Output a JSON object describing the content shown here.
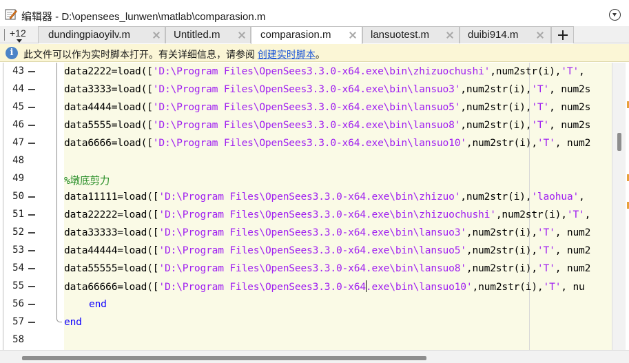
{
  "window": {
    "title": "编辑器 - D:\\opensees_lunwen\\matlab\\comparasion.m",
    "app_icon": "matlab-editor-icon",
    "menu_icon": "chevron-circle-down-icon"
  },
  "tabs": {
    "overflow_count": "+12",
    "items": [
      {
        "label": "dundingpiaoyilv.m",
        "active": false
      },
      {
        "label": "Untitled.m",
        "active": false
      },
      {
        "label": "comparasion.m",
        "active": true
      },
      {
        "label": "lansuotest.m",
        "active": false
      },
      {
        "label": "duibi914.m",
        "active": false
      }
    ],
    "new_tab_icon": "plus-icon"
  },
  "infobar": {
    "text": "此文件可以作为实时脚本打开。有关详细信息，请参阅 ",
    "link": "创建实时脚本",
    "suffix": "。"
  },
  "editor": {
    "lines": [
      {
        "num": "43",
        "dash": true,
        "segments": [
          {
            "t": "n",
            "s": "data2222=load(["
          },
          {
            "t": "s",
            "s": "'D:\\Program Files\\OpenSees3.3.0-x64.exe\\bin\\zhizuochushi'"
          },
          {
            "t": "n",
            "s": ",num2str(i),"
          },
          {
            "t": "s",
            "s": "'T'"
          },
          {
            "t": "n",
            "s": ","
          }
        ]
      },
      {
        "num": "44",
        "dash": true,
        "segments": [
          {
            "t": "n",
            "s": "data3333=load(["
          },
          {
            "t": "s",
            "s": "'D:\\Program Files\\OpenSees3.3.0-x64.exe\\bin\\lansuo3'"
          },
          {
            "t": "n",
            "s": ",num2str(i),"
          },
          {
            "t": "s",
            "s": "'T'"
          },
          {
            "t": "n",
            "s": ", num2s"
          }
        ]
      },
      {
        "num": "45",
        "dash": true,
        "segments": [
          {
            "t": "n",
            "s": "data4444=load(["
          },
          {
            "t": "s",
            "s": "'D:\\Program Files\\OpenSees3.3.0-x64.exe\\bin\\lansuo5'"
          },
          {
            "t": "n",
            "s": ",num2str(i),"
          },
          {
            "t": "s",
            "s": "'T'"
          },
          {
            "t": "n",
            "s": ", num2s"
          }
        ]
      },
      {
        "num": "46",
        "dash": true,
        "segments": [
          {
            "t": "n",
            "s": "data5555=load(["
          },
          {
            "t": "s",
            "s": "'D:\\Program Files\\OpenSees3.3.0-x64.exe\\bin\\lansuo8'"
          },
          {
            "t": "n",
            "s": ",num2str(i),"
          },
          {
            "t": "s",
            "s": "'T'"
          },
          {
            "t": "n",
            "s": ", num2s"
          }
        ]
      },
      {
        "num": "47",
        "dash": true,
        "segments": [
          {
            "t": "n",
            "s": "data6666=load(["
          },
          {
            "t": "s",
            "s": "'D:\\Program Files\\OpenSees3.3.0-x64.exe\\bin\\lansuo10'"
          },
          {
            "t": "n",
            "s": ",num2str(i),"
          },
          {
            "t": "s",
            "s": "'T'"
          },
          {
            "t": "n",
            "s": ", num2"
          }
        ]
      },
      {
        "num": "48",
        "dash": false,
        "segments": []
      },
      {
        "num": "49",
        "dash": false,
        "segments": [
          {
            "t": "c",
            "s": "%墩底剪力"
          }
        ]
      },
      {
        "num": "50",
        "dash": true,
        "segments": [
          {
            "t": "n",
            "s": "data11111=load(["
          },
          {
            "t": "s",
            "s": "'D:\\Program Files\\OpenSees3.3.0-x64.exe\\bin\\zhizuo'"
          },
          {
            "t": "n",
            "s": ",num2str(i),"
          },
          {
            "t": "s",
            "s": "'laohua'"
          },
          {
            "t": "n",
            "s": ","
          }
        ]
      },
      {
        "num": "51",
        "dash": true,
        "segments": [
          {
            "t": "n",
            "s": "data22222=load(["
          },
          {
            "t": "s",
            "s": "'D:\\Program Files\\OpenSees3.3.0-x64.exe\\bin\\zhizuochushi'"
          },
          {
            "t": "n",
            "s": ",num2str(i),"
          },
          {
            "t": "s",
            "s": "'T'"
          },
          {
            "t": "n",
            "s": ","
          }
        ]
      },
      {
        "num": "52",
        "dash": true,
        "segments": [
          {
            "t": "n",
            "s": "data33333=load(["
          },
          {
            "t": "s",
            "s": "'D:\\Program Files\\OpenSees3.3.0-x64.exe\\bin\\lansuo3'"
          },
          {
            "t": "n",
            "s": ",num2str(i),"
          },
          {
            "t": "s",
            "s": "'T'"
          },
          {
            "t": "n",
            "s": ", num2"
          }
        ]
      },
      {
        "num": "53",
        "dash": true,
        "segments": [
          {
            "t": "n",
            "s": "data44444=load(["
          },
          {
            "t": "s",
            "s": "'D:\\Program Files\\OpenSees3.3.0-x64.exe\\bin\\lansuo5'"
          },
          {
            "t": "n",
            "s": ",num2str(i),"
          },
          {
            "t": "s",
            "s": "'T'"
          },
          {
            "t": "n",
            "s": ", num2"
          }
        ]
      },
      {
        "num": "54",
        "dash": true,
        "segments": [
          {
            "t": "n",
            "s": "data55555=load(["
          },
          {
            "t": "s",
            "s": "'D:\\Program Files\\OpenSees3.3.0-x64.exe\\bin\\lansuo8'"
          },
          {
            "t": "n",
            "s": ",num2str(i),"
          },
          {
            "t": "s",
            "s": "'T'"
          },
          {
            "t": "n",
            "s": ", num2"
          }
        ]
      },
      {
        "num": "55",
        "dash": true,
        "caret_after": "'D:\\Program Files\\OpenSees3.3.0-x64",
        "segments": [
          {
            "t": "n",
            "s": "data66666=load(["
          },
          {
            "t": "s",
            "s": "'D:\\Program Files\\OpenSees3.3.0-x64.exe\\bin\\lansuo10'"
          },
          {
            "t": "n",
            "s": ",num2str(i),"
          },
          {
            "t": "s",
            "s": "'T'"
          },
          {
            "t": "n",
            "s": ", nu"
          }
        ]
      },
      {
        "num": "56",
        "dash": true,
        "indent": 1,
        "segments": [
          {
            "t": "k",
            "s": "end"
          }
        ]
      },
      {
        "num": "57",
        "dash": true,
        "segments": [
          {
            "t": "k",
            "s": "end"
          }
        ]
      },
      {
        "num": "58",
        "dash": false,
        "segments": []
      }
    ]
  },
  "colors": {
    "string": "#a020f0",
    "comment": "#228b22",
    "keyword": "#0e00ff",
    "code_background": "#fafae6",
    "info_background": "#fbf6d6"
  }
}
